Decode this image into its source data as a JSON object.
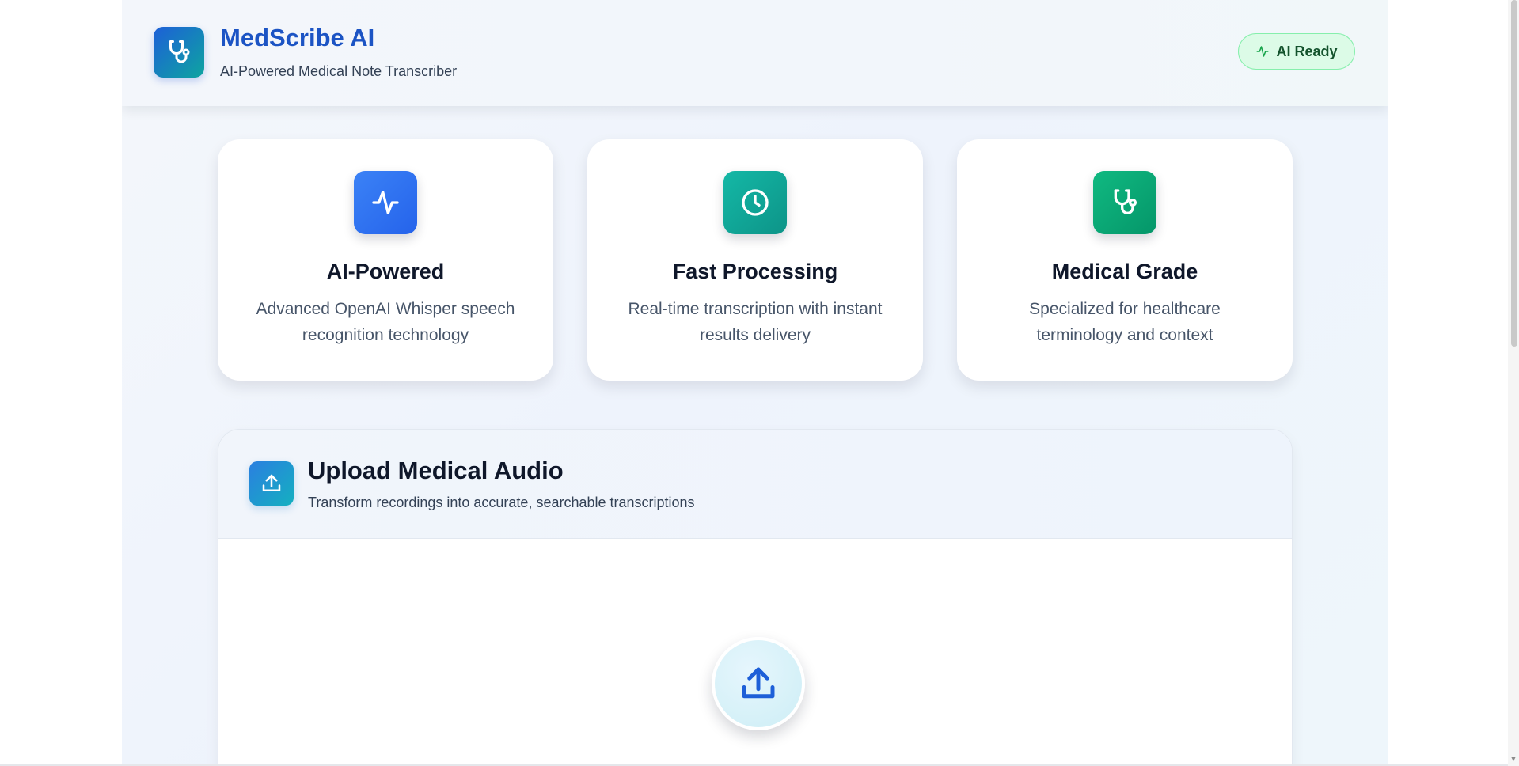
{
  "header": {
    "brand_title": "MedScribe AI",
    "brand_subtitle": "AI-Powered Medical Note Transcriber",
    "status_label": "AI Ready",
    "logo_icon": "stethoscope-icon",
    "status_icon": "activity-icon"
  },
  "features": [
    {
      "title": "AI-Powered",
      "description": "Advanced OpenAI Whisper speech recognition technology",
      "icon": "activity-icon",
      "color": "#2f6ef0"
    },
    {
      "title": "Fast Processing",
      "description": "Real-time transcription with instant results delivery",
      "icon": "clock-icon",
      "color": "#0ea58e"
    },
    {
      "title": "Medical Grade",
      "description": "Specialized for healthcare terminology and context",
      "icon": "stethoscope-icon",
      "color": "#0f9f64"
    }
  ],
  "upload": {
    "title": "Upload Medical Audio",
    "subtitle": "Transform recordings into accurate, searchable transcriptions",
    "icon": "upload-icon",
    "dropzone_icon": "upload-icon"
  },
  "colors": {
    "brand": "#1c54c4",
    "status_bg": "#dcfbe7",
    "status_text": "#14532d"
  }
}
